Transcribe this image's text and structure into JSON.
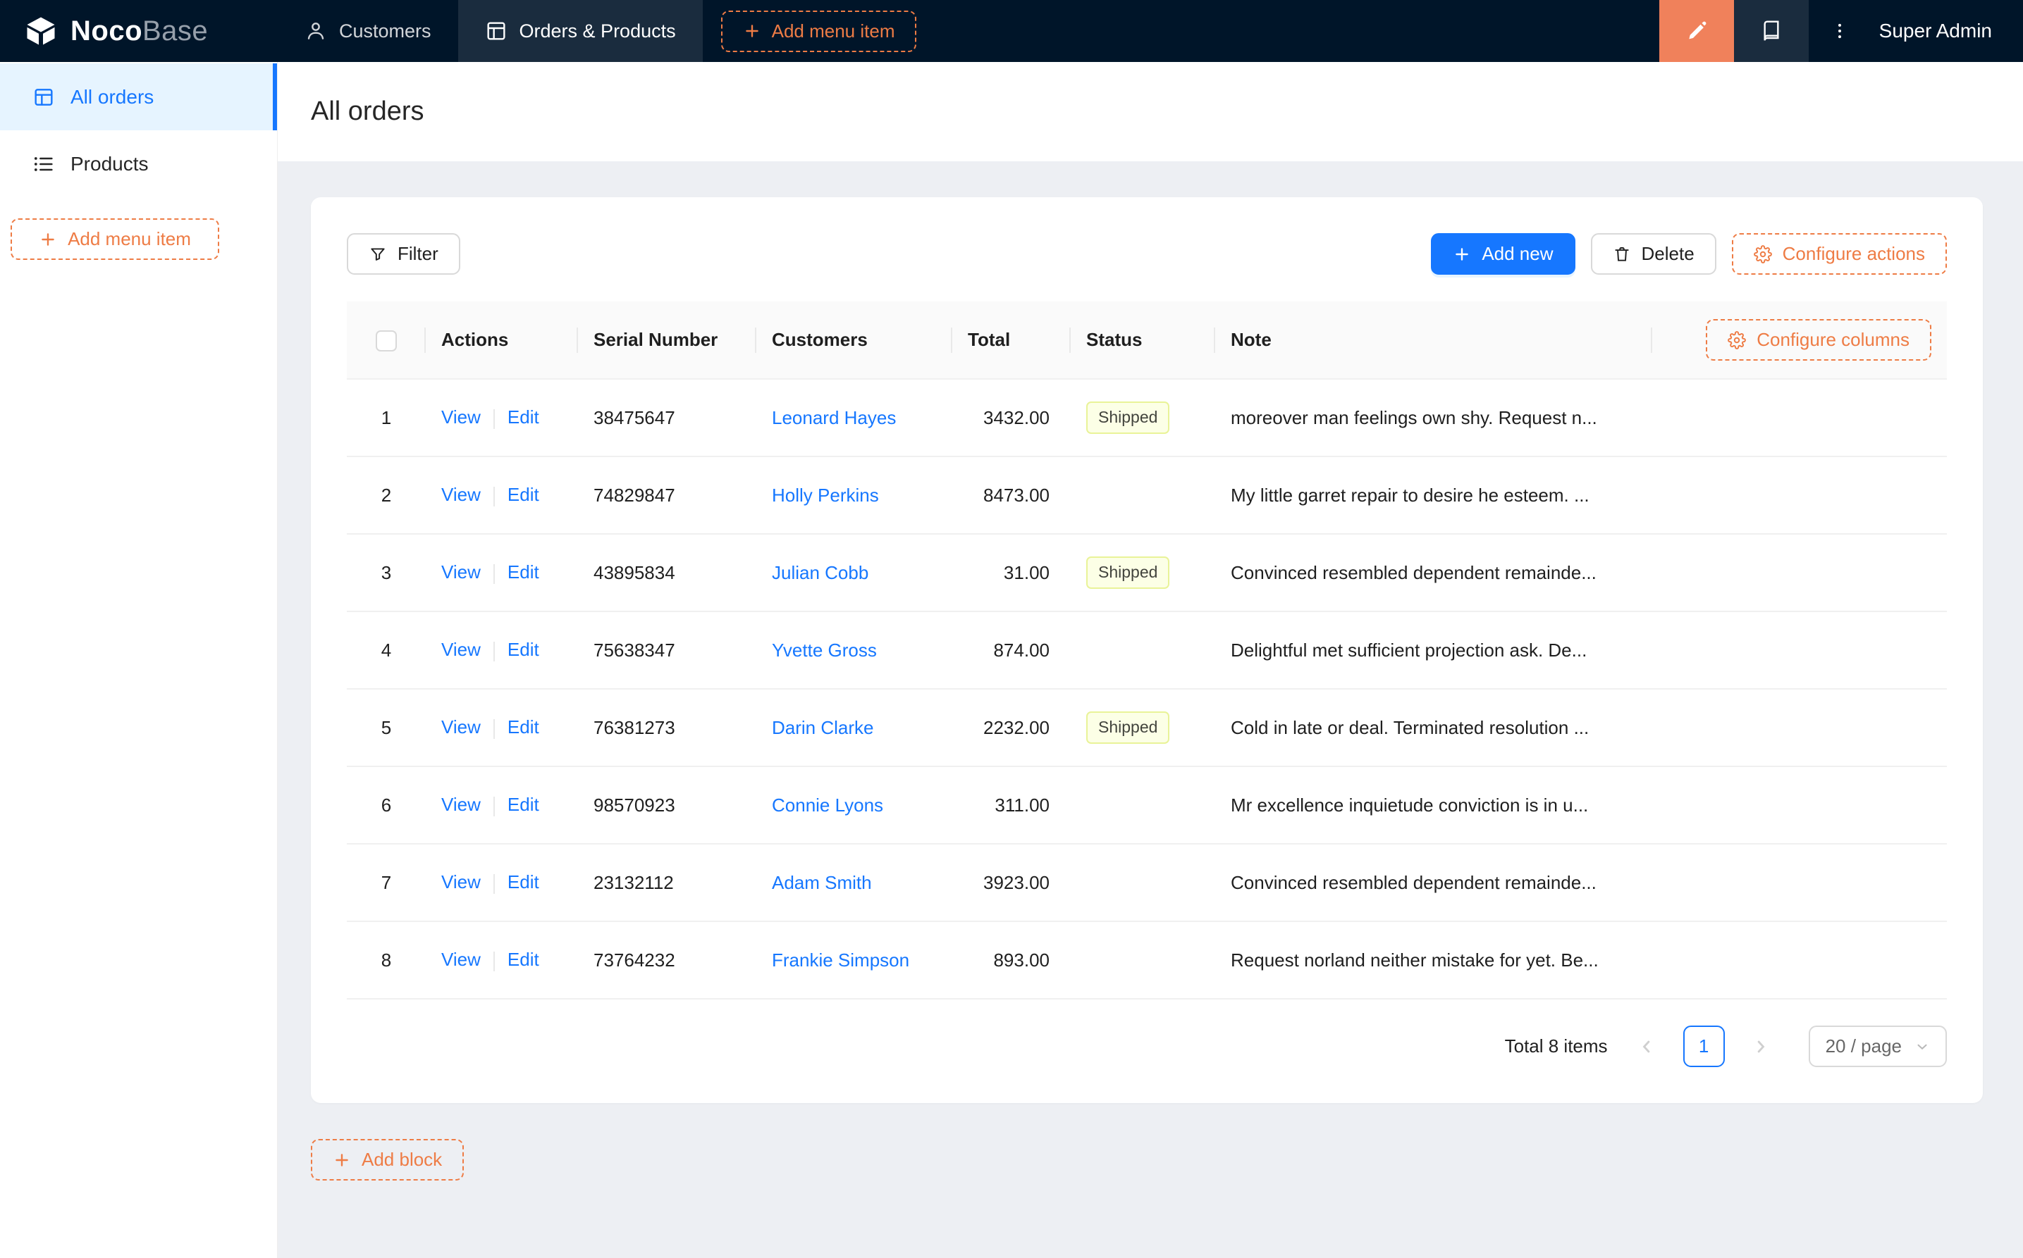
{
  "colors": {
    "navbar_bg": "#001529",
    "accent_orange": "#ee7c45",
    "designer_button_bg": "#f0815b",
    "primary_blue": "#1677ff",
    "selected_sidebar_bg": "#e6f4ff",
    "content_bg": "#edeff3",
    "shipped_tag_bg": "#fcffe6",
    "shipped_tag_border": "#e9f398"
  },
  "icons": {
    "logo": "cube",
    "customers": "person",
    "orders_products": "table-grid",
    "add": "plus",
    "designer": "highlighter-pen",
    "collections": "book",
    "more": "vertical-ellipsis",
    "filter": "funnel",
    "delete": "trash",
    "configure": "gear",
    "all_orders": "table-file",
    "products": "list",
    "prev": "chevron-left",
    "next": "chevron-right",
    "select_open": "chevron-down"
  },
  "navbar": {
    "logo_bold": "Noco",
    "logo_light": "Base",
    "menu": [
      {
        "label": "Customers"
      },
      {
        "label": "Orders & Products"
      }
    ],
    "add_menu_item": "Add menu item",
    "user": "Super Admin"
  },
  "sidebar": {
    "items": [
      {
        "label": "All orders"
      },
      {
        "label": "Products"
      }
    ],
    "add_menu_item": "Add menu item"
  },
  "page": {
    "title": "All orders"
  },
  "toolbar": {
    "filter": "Filter",
    "add_new": "Add new",
    "delete": "Delete",
    "configure_actions": "Configure actions"
  },
  "table": {
    "headers": {
      "actions": "Actions",
      "serial": "Serial Number",
      "customers": "Customers",
      "total": "Total",
      "status": "Status",
      "note": "Note"
    },
    "configure_columns": "Configure columns",
    "view": "View",
    "edit": "Edit",
    "rows": [
      {
        "n": 1,
        "serial": "38475647",
        "customer": "Leonard Hayes",
        "total": "3432.00",
        "status": "Shipped",
        "note": "moreover man feelings own shy. Request n..."
      },
      {
        "n": 2,
        "serial": "74829847",
        "customer": "Holly Perkins",
        "total": "8473.00",
        "note": "My little garret repair to desire he esteem. ..."
      },
      {
        "n": 3,
        "serial": "43895834",
        "customer": "Julian Cobb",
        "total": "31.00",
        "status": "Shipped",
        "note": "Convinced resembled dependent remainde..."
      },
      {
        "n": 4,
        "serial": "75638347",
        "customer": "Yvette Gross",
        "total": "874.00",
        "note": "Delightful met sufficient projection ask. De..."
      },
      {
        "n": 5,
        "serial": "76381273",
        "customer": "Darin Clarke",
        "total": "2232.00",
        "status": "Shipped",
        "note": "Cold in late or deal. Terminated resolution ..."
      },
      {
        "n": 6,
        "serial": "98570923",
        "customer": "Connie Lyons",
        "total": "311.00",
        "note": "Mr excellence inquietude conviction is in u..."
      },
      {
        "n": 7,
        "serial": "23132112",
        "customer": "Adam Smith",
        "total": "3923.00",
        "note": "Convinced resembled dependent remainde..."
      },
      {
        "n": 8,
        "serial": "73764232",
        "customer": "Frankie Simpson",
        "total": "893.00",
        "note": "Request norland neither mistake for yet. Be..."
      }
    ]
  },
  "pagination": {
    "total": "Total 8 items",
    "page": "1",
    "page_size": "20 / page"
  },
  "add_block": "Add block"
}
